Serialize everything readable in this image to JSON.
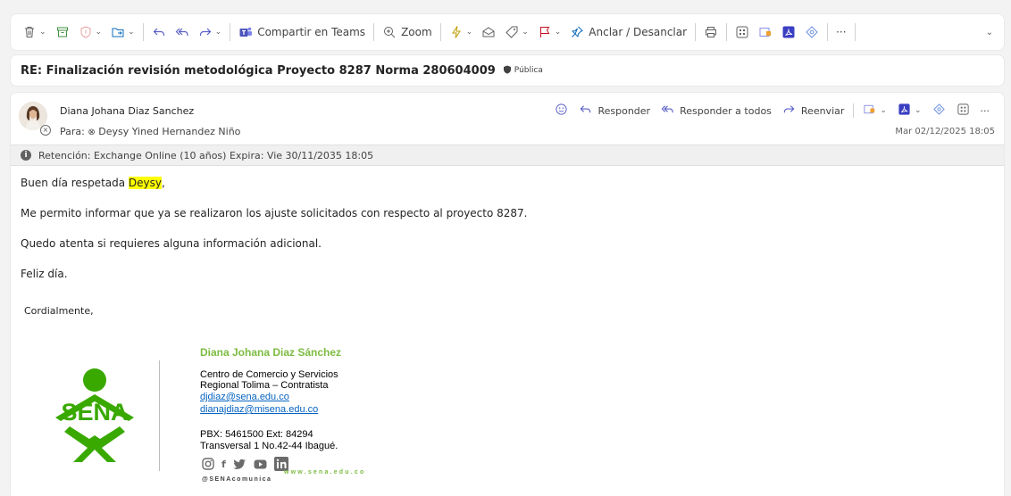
{
  "toolbar": {
    "teams_label": "Compartir en Teams",
    "zoom_label": "Zoom",
    "pin_label": "Anclar / Desanclar",
    "more_label": "···",
    "chevron": "⌄"
  },
  "message": {
    "subject": "RE: Finalización revisión metodológica Proyecto 8287 Norma 280604009",
    "sensitivity": "Pública",
    "sender": "Diana Johana Diaz Sanchez",
    "to_prefix": "Para:",
    "to": "Deysy Yined Hernandez Niño",
    "date": "Mar 02/12/2025 18:05",
    "retention": "Retención: Exchange Online (10 años) Expira: Vie 30/11/2035 18:05"
  },
  "actions": {
    "reply": "Responder",
    "reply_all": "Responder a todos",
    "forward": "Reenviar",
    "more": "···"
  },
  "body": {
    "greeting_prefix": "Buen día respetada ",
    "greeting_name": "Deysy",
    "greeting_suffix": ",",
    "line1": "Me permito informar que ya se realizaron los ajuste solicitados con respecto al proyecto 8287.",
    "line2": "Quedo atenta si requieres alguna información adicional.",
    "line3": "Feliz día.",
    "closing": "Cordialmente,"
  },
  "signature": {
    "name": "Diana Johana Diaz Sánchez",
    "center": "Centro de Comercio y Servicios",
    "role": "Regional Tolima – Contratista",
    "email1": "djdiaz@sena.edu.co",
    "email2": "dianajdiaz@misena.edu.co",
    "phone": "PBX: 5461500 Ext: 84294",
    "address": "Transversal 1 No.42-44 Ibagué.",
    "logo_text": "SENA",
    "handle": "@SENAcomunica",
    "web": "www.sena.edu.co"
  },
  "colors": {
    "sena_green": "#39a900",
    "signature_green": "#7dbb42",
    "link": "#0563c1",
    "highlight": "#ffff00"
  }
}
